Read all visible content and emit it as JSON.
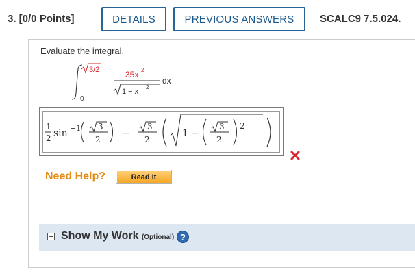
{
  "header": {
    "question_number": "3. [0/0 Points]",
    "details_label": "DETAILS",
    "previous_answers_label": "PREVIOUS ANSWERS",
    "reference": "SCALC9 7.5.024."
  },
  "question": {
    "prompt": "Evaluate the integral.",
    "integral": {
      "upper_limit": "√3/2",
      "lower_limit": "0",
      "numerator": "35x²",
      "denominator": "√(1 − x²)",
      "differential": "dx"
    }
  },
  "answer": {
    "expression": "1/2 sin^(-1)(√3/2) − (√3/2)(√(1 − (√3/2)^2))",
    "status": "incorrect",
    "status_color": "#d9232d"
  },
  "help": {
    "need_help_label": "Need Help?",
    "read_it_label": "Read It"
  },
  "show_my_work": {
    "toggle_symbol": "+",
    "label": "Show My Work",
    "optional_label": "(Optional)",
    "help_symbol": "?"
  }
}
